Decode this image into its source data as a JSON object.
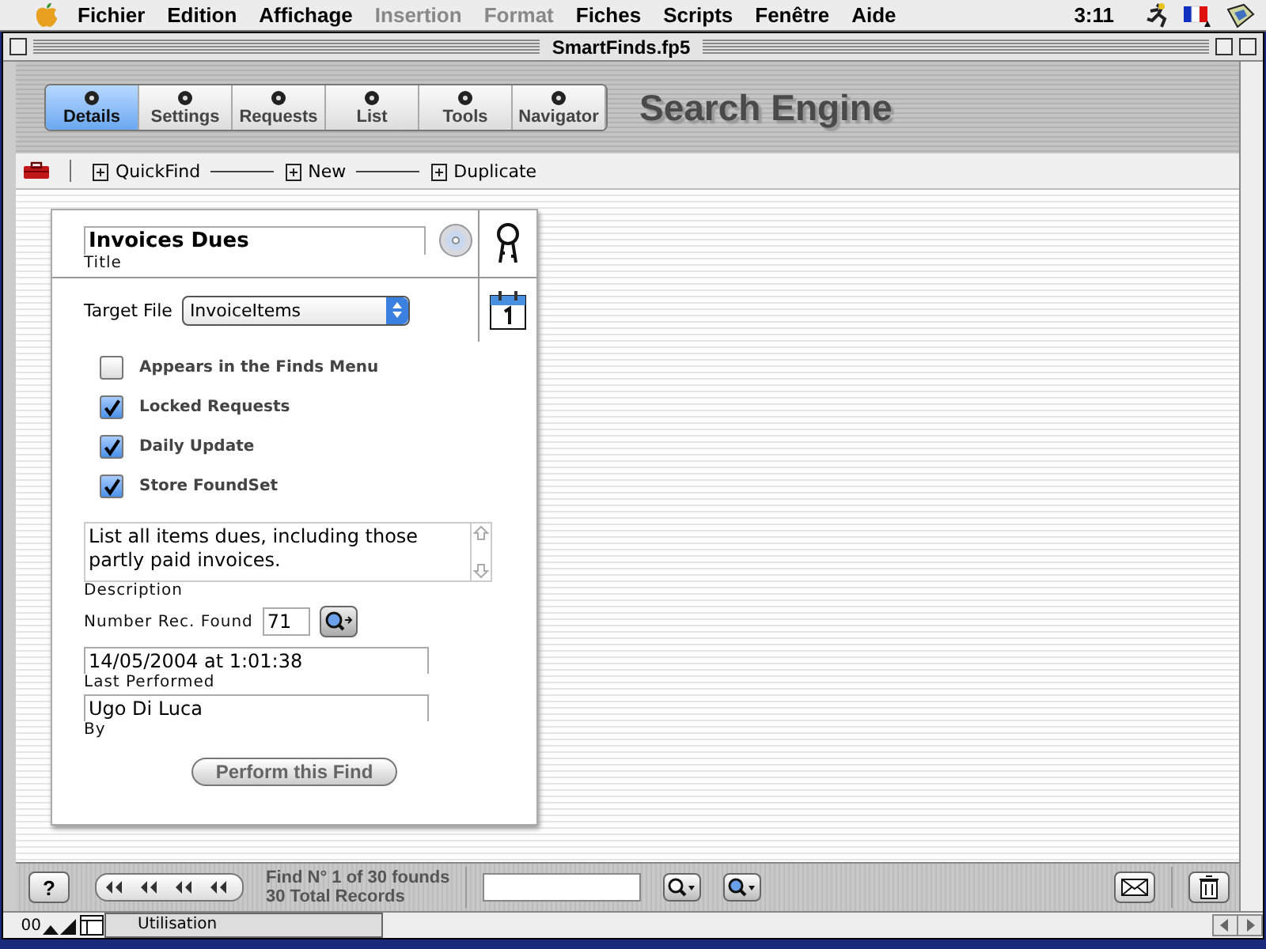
{
  "menu_bar": {
    "items": [
      {
        "label": "Fichier",
        "disabled": false
      },
      {
        "label": "Edition",
        "disabled": false
      },
      {
        "label": "Affichage",
        "disabled": false
      },
      {
        "label": "Insertion",
        "disabled": true
      },
      {
        "label": "Format",
        "disabled": true
      },
      {
        "label": "Fiches",
        "disabled": false
      },
      {
        "label": "Scripts",
        "disabled": false
      },
      {
        "label": "Fenêtre",
        "disabled": false
      },
      {
        "label": "Aide",
        "disabled": false
      }
    ],
    "clock": "3:11"
  },
  "window": {
    "title": "SmartFinds.fp5"
  },
  "tabs": [
    {
      "label": "Details",
      "selected": true
    },
    {
      "label": "Settings",
      "selected": false
    },
    {
      "label": "Requests",
      "selected": false
    },
    {
      "label": "List",
      "selected": false
    },
    {
      "label": "Tools",
      "selected": false
    },
    {
      "label": "Navigator",
      "selected": false
    }
  ],
  "header_title": "Search Engine",
  "toolbar": [
    {
      "label": "QuickFind"
    },
    {
      "label": "New"
    },
    {
      "label": "Duplicate"
    }
  ],
  "card": {
    "title": {
      "value": "Invoices Dues",
      "label": "Title"
    },
    "target_file": {
      "label": "Target File",
      "value": "InvoiceItems"
    },
    "checkboxes": [
      {
        "label": "Appears in the Finds Menu",
        "checked": false
      },
      {
        "label": "Locked Requests",
        "checked": true
      },
      {
        "label": "Daily Update",
        "checked": true
      },
      {
        "label": "Store FoundSet",
        "checked": true
      }
    ],
    "description": {
      "value": "List all items dues, including those partly paid invoices.",
      "label": "Description"
    },
    "records_found": {
      "label": "Number Rec. Found",
      "value": "71"
    },
    "last_performed": {
      "value": "14/05/2004 at 1:01:38",
      "label": "Last Performed"
    },
    "by": {
      "value": "Ugo Di Luca",
      "label": "By"
    },
    "button": "Perform this Find"
  },
  "bottom_bar": {
    "help": "?",
    "status_line": "Find N° 1 of 30 founds",
    "total_line": "30 Total Records"
  },
  "status_bar": {
    "zoom": "00",
    "mode": "Utilisation"
  }
}
